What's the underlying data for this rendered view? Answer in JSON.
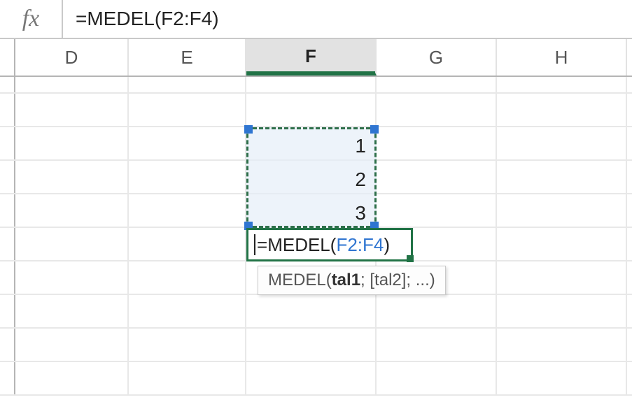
{
  "formula_bar": {
    "fx_label": "fx",
    "formula_text": "=MEDEL(F2:F4)"
  },
  "columns": [
    "D",
    "E",
    "F",
    "G",
    "H"
  ],
  "active_column": "F",
  "values": {
    "F2": "1",
    "F3": "2",
    "F4": "3"
  },
  "edit_cell": {
    "address": "F5",
    "prefix": "=",
    "fn": "MEDEL",
    "open": "(",
    "ref": "F2:F4",
    "close": ")"
  },
  "tooltip": {
    "fn": "MEDEL",
    "open": "(",
    "arg_bold": "tal1",
    "rest": "; [tal2]; ...)"
  }
}
